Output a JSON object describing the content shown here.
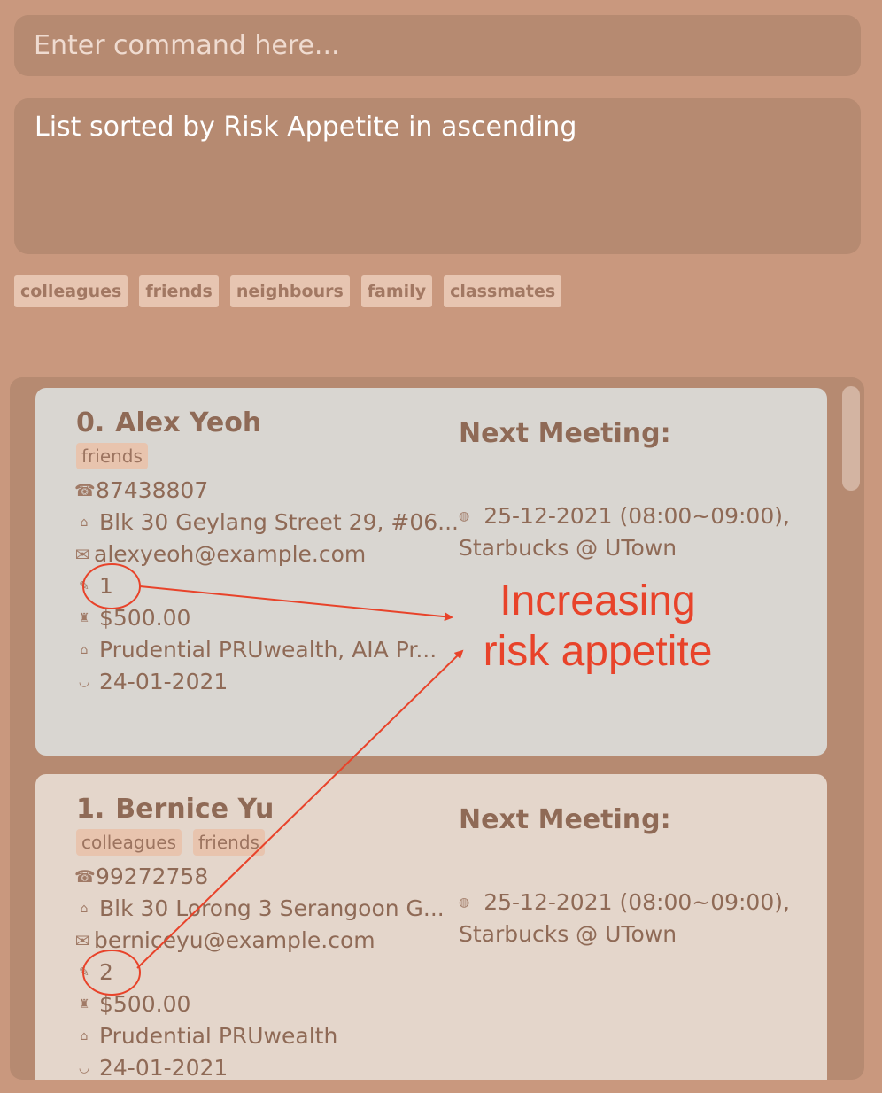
{
  "command": {
    "placeholder": "Enter command here..."
  },
  "result": {
    "message": "List sorted by Risk Appetite in ascending"
  },
  "tag_filters": [
    "colleagues",
    "friends",
    "neighbours",
    "family",
    "classmates"
  ],
  "persons": [
    {
      "index": "0.",
      "name": "Alex Yeoh",
      "tags": [
        "friends"
      ],
      "phone": "87438807",
      "address": "Blk 30 Geylang Street 29, #06...",
      "email": "alexyeoh@example.com",
      "risk_appetite": "1",
      "disposable_income": "$500.00",
      "plans": "Prudential PRUwealth, AIA Pr...",
      "last_met": "24-01-2021",
      "next_meeting_title": "Next Meeting:",
      "next_meeting_time": "25-12-2021 (08:00~09:00),",
      "next_meeting_location": "Starbucks @ UTown"
    },
    {
      "index": "1.",
      "name": "Bernice Yu",
      "tags": [
        "colleagues",
        "friends"
      ],
      "phone": "99272758",
      "address": "Blk 30 Lorong 3 Serangoon G...",
      "email": "berniceyu@example.com",
      "risk_appetite": "2",
      "disposable_income": "$500.00",
      "plans": "Prudential PRUwealth",
      "last_met": "24-01-2021",
      "next_meeting_title": "Next Meeting:",
      "next_meeting_time": "25-12-2021 (08:00~09:00),",
      "next_meeting_location": "Starbucks @ UTown"
    }
  ],
  "annotation": {
    "line1": "Increasing",
    "line2": "risk appetite",
    "color": "#e8432a"
  },
  "icons": {
    "phone": "phone-icon",
    "address": "home-icon",
    "email": "envelope-icon",
    "risk": "risk-appetite-icon",
    "income": "money-bag-icon",
    "plans": "bank-icon",
    "last_met": "handshake-icon",
    "meeting": "clock-icon"
  },
  "colors": {
    "background": "#c9987e",
    "panel": "#b68a71",
    "card_selected": "#d9d6d1",
    "card": "#e4d6cb",
    "tag": "#e8c4ae",
    "text": "#8f6a56"
  }
}
